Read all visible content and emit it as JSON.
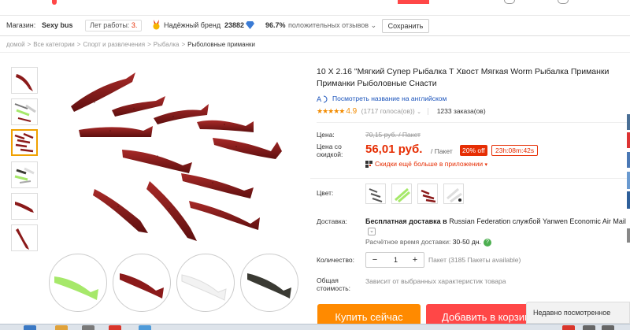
{
  "store": {
    "label": "Магазин:",
    "name": "Sexy bus",
    "years_label": "Лет работы:",
    "years_value": "3",
    "brand_label": "Надёжный бренд",
    "score": "23882",
    "positive_pct": "96.7%",
    "positive_label": "положительных отзывов",
    "save_button": "Сохранить"
  },
  "breadcrumb": [
    {
      "label": "домой",
      "current": false
    },
    {
      "label": ">",
      "current": false
    },
    {
      "label": "Все категории",
      "current": false
    },
    {
      "label": ">",
      "current": false
    },
    {
      "label": "Спорт и развлечения",
      "current": false
    },
    {
      "label": ">",
      "current": false
    },
    {
      "label": "Рыбалка",
      "current": false
    },
    {
      "label": ">",
      "current": false
    },
    {
      "label": "Рыболовные приманки",
      "current": true
    }
  ],
  "product": {
    "title": "10 X 2.16 \"Мягкий Супер Рыбалка Т Хвост Мягкая Worm Рыбалка Приманки Приманки Рыболовные Снасти",
    "translate_link": "Посмотреть название на английском",
    "rating_stars": "★★★★★",
    "rating": "4.9",
    "votes": "(1717 голоса(ов))",
    "orders": "1233 заказа(ов)"
  },
  "price": {
    "label": "Цена:",
    "old": "70,15 руб. / Пакет",
    "sale_label_1": "Цена со",
    "sale_label_2": "скидкой:",
    "new": "56,01 руб.",
    "unit": "/ Пакет",
    "discount": "20% off",
    "timer": "23h:08m:42s",
    "app_discount": "Скидки ещё больше в приложении"
  },
  "options": {
    "color_label": "Цвет:",
    "shipping_label": "Доставка:",
    "shipping_free": "Бесплатная доставка в",
    "shipping_country": "Russian Federation",
    "shipping_via": "службой",
    "shipping_carrier": "Yanwen Economic Air Mail",
    "delivery_time_label": "Расчётное время доставки:",
    "delivery_time": "30-50 дн.",
    "quantity_label": "Количество:",
    "quantity": "1",
    "minus": "−",
    "plus": "+",
    "quantity_available": "Пакет (3185 Пакеты available)",
    "total_label_1": "Общая",
    "total_label_2": "стоимость:",
    "total_text": "Зависит от выбранных характеристик товара"
  },
  "actions": {
    "buy_now": "Купить сейчас",
    "add_to_cart": "Добавить в корзину"
  },
  "recently_viewed": "Недавно посмотренное",
  "colors": {
    "accent": "#e62e04",
    "buy": "#ff8a00",
    "cart": "#ff4747",
    "link": "#1a53bb",
    "star": "#f28b00",
    "lure_red": "#8b1a1a",
    "lure_green": "#a6e86a",
    "lure_white": "#f2f2f2",
    "lure_dark": "#3a3a33"
  }
}
